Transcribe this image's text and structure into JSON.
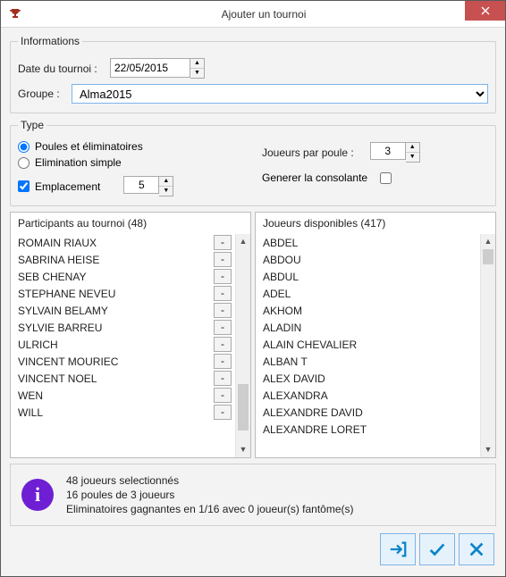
{
  "window": {
    "title": "Ajouter un tournoi"
  },
  "informations": {
    "legend": "Informations",
    "date_label": "Date du tournoi :",
    "date_value": "22/05/2015",
    "groupe_label": "Groupe :",
    "groupe_value": "Alma2015"
  },
  "type": {
    "legend": "Type",
    "radio_poules": "Poules et éliminatoires",
    "radio_elim": "Elimination simple",
    "check_emplacement": "Emplacement",
    "emplacement_value": "5",
    "joueurs_label": "Joueurs par poule :",
    "joueurs_value": "3",
    "generer_label": "Generer la consolante"
  },
  "participants": {
    "header": "Participants au tournoi (48)",
    "count": 48,
    "items": [
      "ROMAIN RIAUX",
      "SABRINA HEISE",
      "SEB CHENAY",
      "STEPHANE NEVEU",
      "SYLVAIN  BELAMY",
      "SYLVIE BARREU",
      "ULRICH",
      "VINCENT MOURIEC",
      "VINCENT NOEL",
      "WEN",
      "WILL"
    ]
  },
  "disponibles": {
    "header": "Joueurs disponibles (417)",
    "count": 417,
    "items": [
      "ABDEL",
      "ABDOU",
      "ABDUL",
      "ADEL",
      "AKHOM",
      "ALADIN",
      "ALAIN CHEVALIER",
      "ALBAN T",
      "ALEX DAVID",
      "ALEXANDRA",
      "ALEXANDRE DAVID",
      "ALEXANDRE LORET"
    ]
  },
  "info": {
    "line1": "48 joueurs selectionnés",
    "line2": "16 poules de 3 joueurs",
    "line3": "Eliminatoires gagnantes en 1/16 avec 0 joueur(s) fantôme(s)"
  }
}
